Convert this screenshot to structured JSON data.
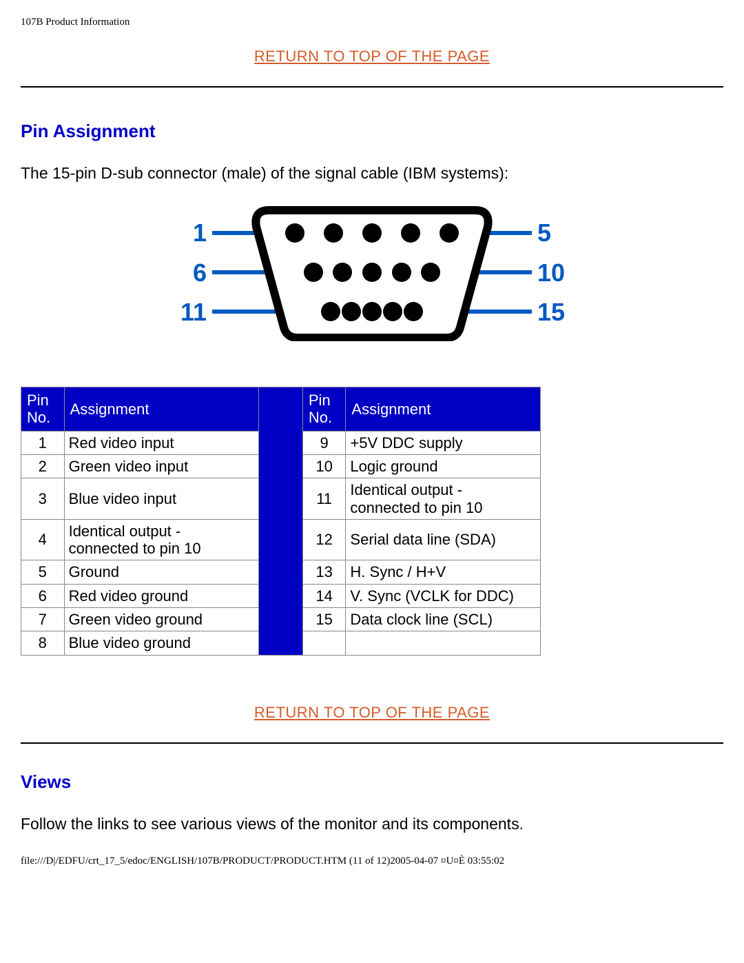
{
  "header": "107B Product Information",
  "topLink1": "RETURN TO TOP OF THE PAGE",
  "topLink2": "RETURN TO TOP OF THE PAGE",
  "section1": "Pin Assignment",
  "intro": "The 15-pin D-sub connector (male) of the signal cable (IBM systems):",
  "diagram": {
    "left": [
      "1",
      "6",
      "11"
    ],
    "right": [
      "5",
      "10",
      "15"
    ]
  },
  "tableHeaders": {
    "pin": "Pin\nNo.",
    "assign": "Assignment"
  },
  "pinsLeft": [
    {
      "no": "1",
      "a": "Red video input"
    },
    {
      "no": "2",
      "a": "Green video input"
    },
    {
      "no": "3",
      "a": "Blue video input"
    },
    {
      "no": "4",
      "a": "Identical output - connected to pin 10"
    },
    {
      "no": "5",
      "a": "Ground"
    },
    {
      "no": "6",
      "a": "Red video ground"
    },
    {
      "no": "7",
      "a": "Green video ground"
    },
    {
      "no": "8",
      "a": "Blue video ground"
    }
  ],
  "pinsRight": [
    {
      "no": "9",
      "a": "+5V DDC supply"
    },
    {
      "no": "10",
      "a": "Logic ground"
    },
    {
      "no": "11",
      "a": "Identical output - connected to pin 10"
    },
    {
      "no": "12",
      "a": "Serial data line (SDA)"
    },
    {
      "no": "13",
      "a": "H. Sync / H+V"
    },
    {
      "no": "14",
      "a": "V. Sync (VCLK for DDC)"
    },
    {
      "no": "15",
      "a": "Data clock line (SCL)"
    },
    {
      "no": "",
      "a": ""
    }
  ],
  "section2": "Views",
  "viewsBody": "Follow the links to see various views of the monitor and its components.",
  "footer": "file:///D|/EDFU/crt_17_5/edoc/ENGLISH/107B/PRODUCT/PRODUCT.HTM (11 of 12)2005-04-07 ¤U¤È 03:55:02"
}
